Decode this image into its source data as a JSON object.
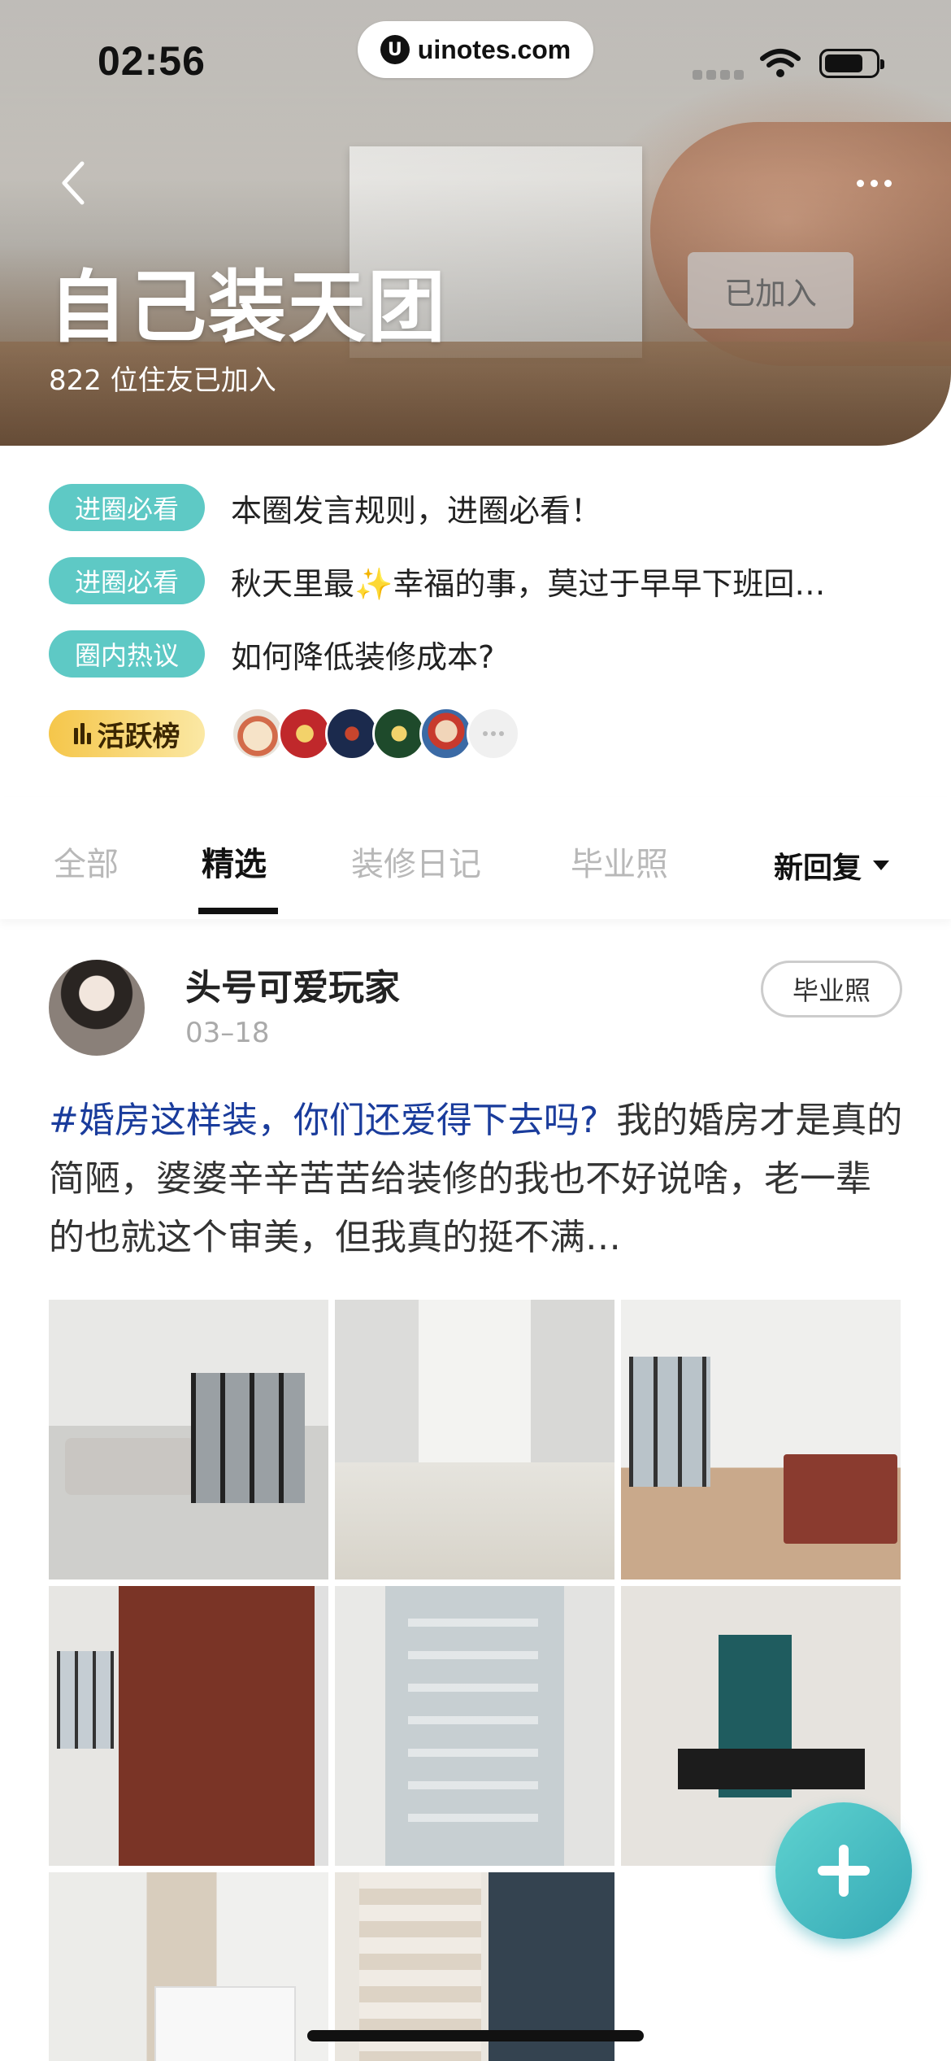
{
  "status_bar": {
    "time": "02:56",
    "url": "uinotes.com"
  },
  "header": {
    "title": "自己装天团",
    "member_count": "822 位住友已加入",
    "join_button": "已加入"
  },
  "topics": [
    {
      "tag": "进圈必看",
      "text": "本圈发言规则，进圈必看！"
    },
    {
      "tag": "进圈必看",
      "text": "秋天里最✨幸福的事，莫过于早早下班回…"
    },
    {
      "tag": "圈内热议",
      "text": "如何降低装修成本?"
    }
  ],
  "ranking": {
    "label": "活跃榜"
  },
  "tabs": [
    {
      "label": "全部"
    },
    {
      "label": "精选"
    },
    {
      "label": "装修日记"
    },
    {
      "label": "毕业照"
    }
  ],
  "active_tab": "精选",
  "sort": {
    "label": "新回复"
  },
  "post": {
    "author": "头号可爱玩家",
    "date": "03–18",
    "badge": "毕业照",
    "hashtag": "#婚房这样装，你们还爱得下去吗?",
    "body": "我的婚房才是真的简陋，婆婆辛辛苦苦给装修的我也不好说啥，老一辈的也就这个审美，但我真的挺不满…"
  },
  "colors": {
    "accent": "#5ec9c5",
    "fab": "#4bbfc6",
    "hashtag": "#1a3c9c",
    "rank_gold": "#f5c64a"
  }
}
